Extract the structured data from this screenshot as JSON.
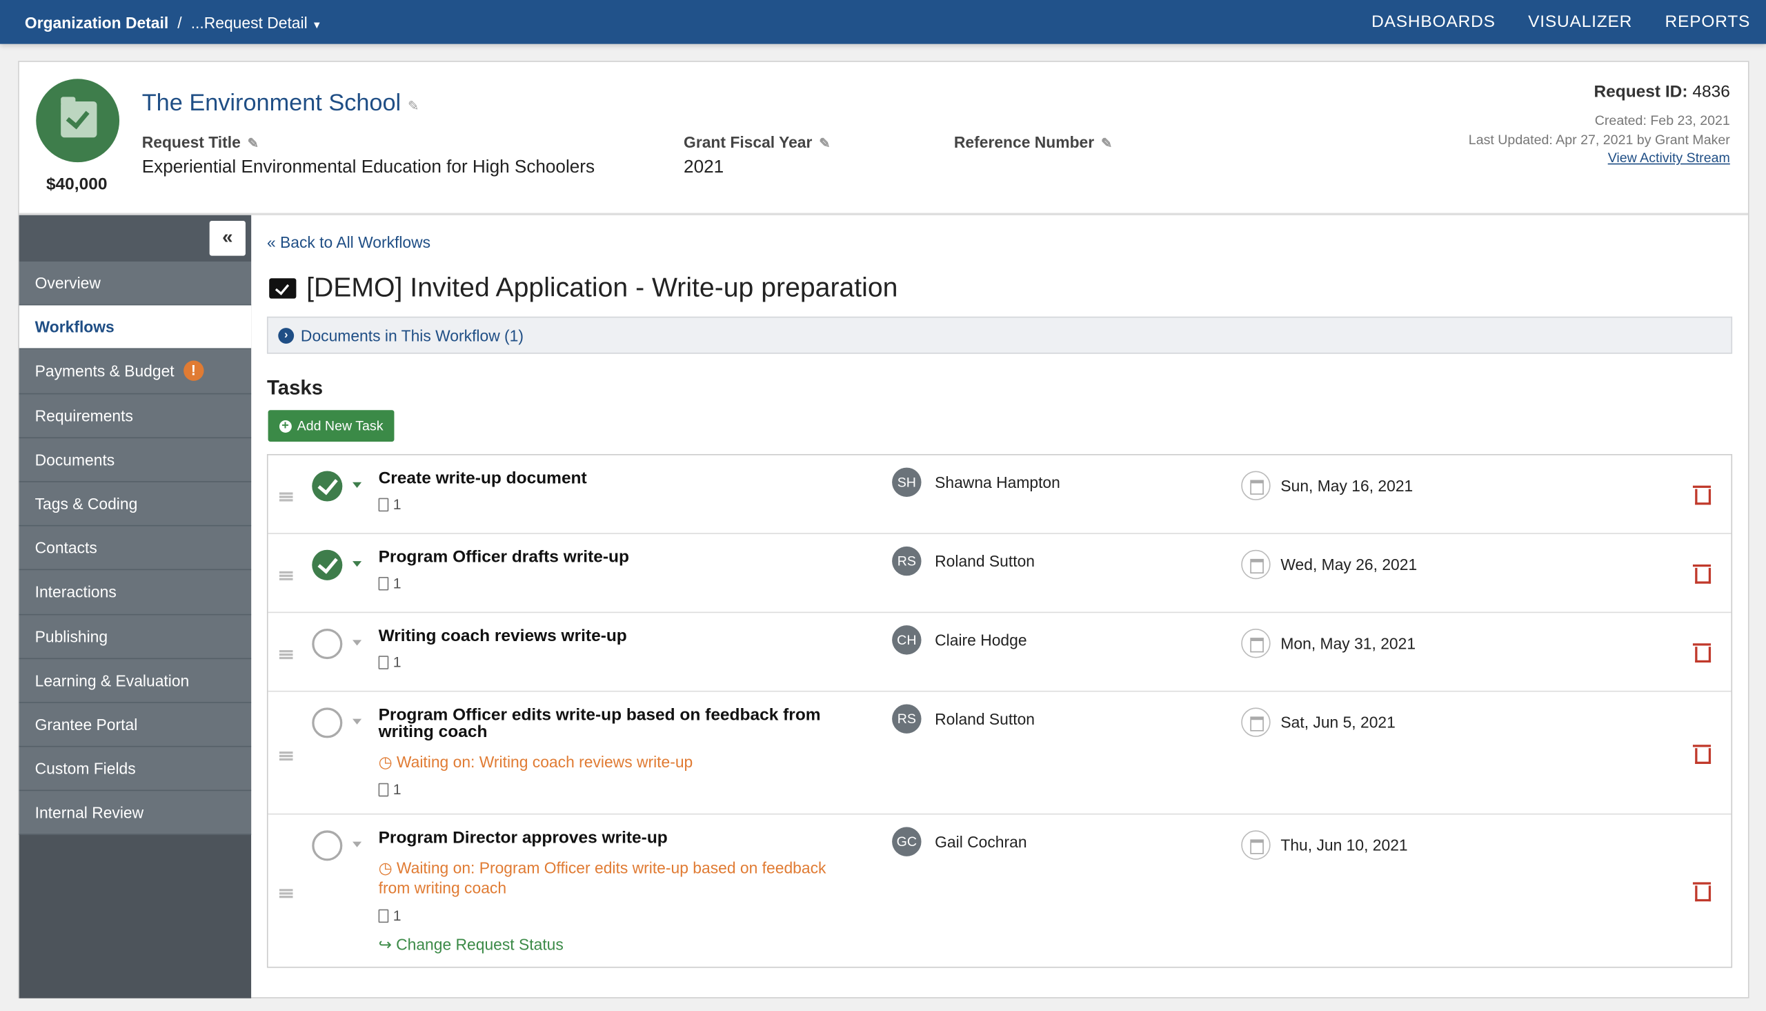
{
  "topbar": {
    "breadcrumb_root": "Organization Detail",
    "separator": "/",
    "breadcrumb_current": "...Request Detail",
    "nav": [
      "DASHBOARDS",
      "VISUALIZER",
      "REPORTS"
    ]
  },
  "header": {
    "org_name": "The Environment School",
    "amount": "$40,000",
    "fields": [
      {
        "label": "Request Title",
        "value": "Experiential Environmental Education for High Schoolers"
      },
      {
        "label": "Grant Fiscal Year",
        "value": "2021"
      },
      {
        "label": "Reference Number",
        "value": ""
      }
    ],
    "request_id_label": "Request ID:",
    "request_id": "4836",
    "created": "Created: Feb 23, 2021",
    "last_updated": "Last Updated: Apr 27, 2021 by Grant Maker",
    "activity_link": "View Activity Stream"
  },
  "sidebar": {
    "collapse": "«",
    "items": [
      "Overview",
      "Workflows",
      "Payments & Budget",
      "Requirements",
      "Documents",
      "Tags & Coding",
      "Contacts",
      "Interactions",
      "Publishing",
      "Learning & Evaluation",
      "Grantee Portal",
      "Custom Fields",
      "Internal Review"
    ],
    "active": "Workflows",
    "alert_badge": "!"
  },
  "main": {
    "back": "« Back to All Workflows",
    "title": "[DEMO] Invited Application - Write-up preparation",
    "docs": "Documents in This Workflow (1)",
    "tasks_heading": "Tasks",
    "add_task": "Add New Task",
    "tasks": [
      {
        "title": "Create write-up document",
        "done": true,
        "initials": "SH",
        "assignee": "Shawna Hampton",
        "date": "Sun, May 16, 2021",
        "docs": "1"
      },
      {
        "title": "Program Officer drafts write-up",
        "done": true,
        "initials": "RS",
        "assignee": "Roland Sutton",
        "date": "Wed, May 26, 2021",
        "docs": "1"
      },
      {
        "title": "Writing coach reviews write-up",
        "done": false,
        "initials": "CH",
        "assignee": "Claire Hodge",
        "date": "Mon, May 31, 2021",
        "docs": "1"
      },
      {
        "title": "Program Officer edits write-up based on feedback from writing coach",
        "done": false,
        "waiting": "Waiting on: Writing coach reviews write-up",
        "initials": "RS",
        "assignee": "Roland Sutton",
        "date": "Sat, Jun 5, 2021",
        "docs": "1"
      },
      {
        "title": "Program Director approves write-up",
        "done": false,
        "waiting": "Waiting on: Program Officer edits write-up based on feedback from writing coach",
        "initials": "GC",
        "assignee": "Gail Cochran",
        "date": "Thu, Jun 10, 2021",
        "docs": "1",
        "action": "Change Request Status"
      }
    ]
  },
  "colors": {
    "brand": "#21528a",
    "success": "#3e7d4b",
    "warning": "#e07b33",
    "danger": "#c0392b"
  }
}
